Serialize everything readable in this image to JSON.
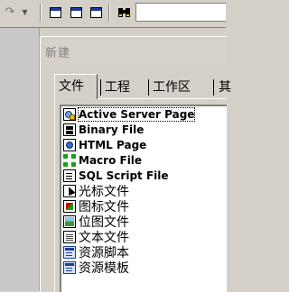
{
  "toolbar": {
    "redo_icon": "redo-arrow-icon",
    "redo_dropdown_icon": "chevron-down-icon",
    "window_icons": [
      "window-icon",
      "window-icon",
      "window-icon"
    ],
    "find_icon": "binoculars-icon",
    "find_input_value": ""
  },
  "dialog": {
    "title": "新建",
    "tabs": [
      {
        "label": "文件",
        "active": true
      },
      {
        "label": "工程",
        "active": false
      },
      {
        "label": "工作区",
        "active": false
      },
      {
        "label": "其",
        "active": false
      }
    ],
    "items": [
      {
        "label": "Active Server Page",
        "icon": "asp-file-icon",
        "selected": true
      },
      {
        "label": "Binary File",
        "icon": "binary-file-icon"
      },
      {
        "label": "HTML Page",
        "icon": "html-page-icon"
      },
      {
        "label": "Macro File",
        "icon": "macro-file-icon"
      },
      {
        "label": "SQL Script File",
        "icon": "sql-script-icon"
      },
      {
        "label": "光标文件",
        "icon": "cursor-file-icon"
      },
      {
        "label": "图标文件",
        "icon": "icon-file-icon"
      },
      {
        "label": "位图文件",
        "icon": "bitmap-file-icon"
      },
      {
        "label": "文本文件",
        "icon": "text-file-icon"
      },
      {
        "label": "资源脚本",
        "icon": "resource-script-icon"
      },
      {
        "label": "资源模板",
        "icon": "resource-template-icon"
      }
    ]
  },
  "colors": {
    "face": "#d4d0c8",
    "shadow": "#808080",
    "highlight": "#ffffff",
    "accent": "#1c3d9c"
  }
}
